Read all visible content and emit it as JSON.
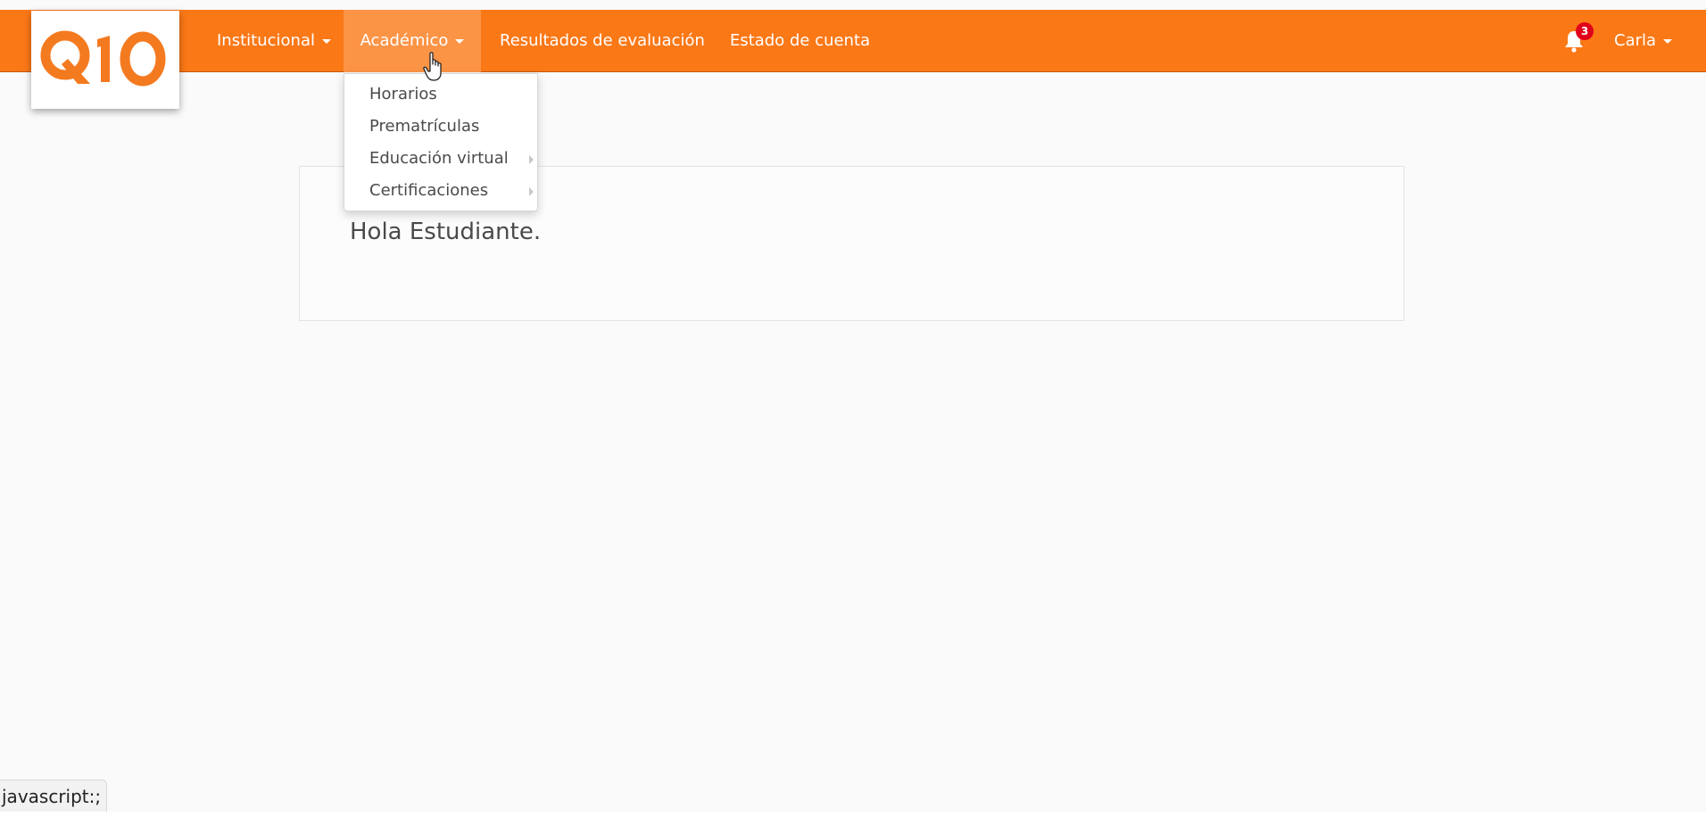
{
  "brand": {
    "logo_text": "Q10",
    "primary_color": "#fb7817",
    "active_color": "#fc9446"
  },
  "nav": {
    "items": [
      {
        "label": "Institucional",
        "has_caret": true
      },
      {
        "label": "Académico",
        "has_caret": true,
        "active": true
      },
      {
        "label": "Resultados de evaluación",
        "has_caret": false
      },
      {
        "label": "Estado de cuenta",
        "has_caret": false
      }
    ],
    "notifications": {
      "icon": "bell-icon",
      "count": "3"
    },
    "user": {
      "label": "Carla"
    }
  },
  "dropdown": {
    "items": [
      {
        "label": "Horarios",
        "submenu": false
      },
      {
        "label": "Prematrículas",
        "submenu": false
      },
      {
        "label": "Educación virtual",
        "submenu": true
      },
      {
        "label": "Certificaciones",
        "submenu": true
      }
    ]
  },
  "main": {
    "greeting": "Hola Estudiante."
  },
  "status_bar": {
    "text": "javascript:;"
  }
}
